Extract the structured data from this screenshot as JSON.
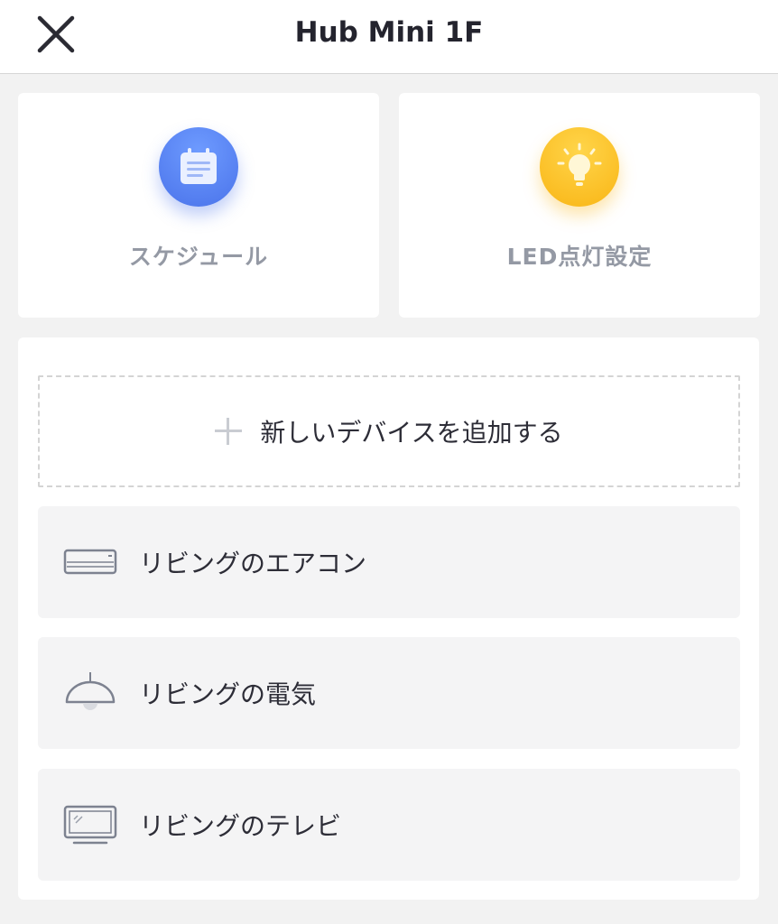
{
  "header": {
    "title": "Hub Mini 1F",
    "close_icon": "close-icon"
  },
  "features": [
    {
      "label": "スケジュール",
      "icon": "calendar-icon",
      "color": "#4f7bf0"
    },
    {
      "label": "LED点灯設定",
      "icon": "lightbulb-icon",
      "color": "#fbbd22"
    }
  ],
  "add_device": {
    "label": "新しいデバイスを追加する",
    "icon": "plus-icon"
  },
  "devices": [
    {
      "name": "リビングのエアコン",
      "icon": "air-conditioner-icon"
    },
    {
      "name": "リビングの電気",
      "icon": "ceiling-light-icon"
    },
    {
      "name": "リビングのテレビ",
      "icon": "tv-icon"
    }
  ]
}
